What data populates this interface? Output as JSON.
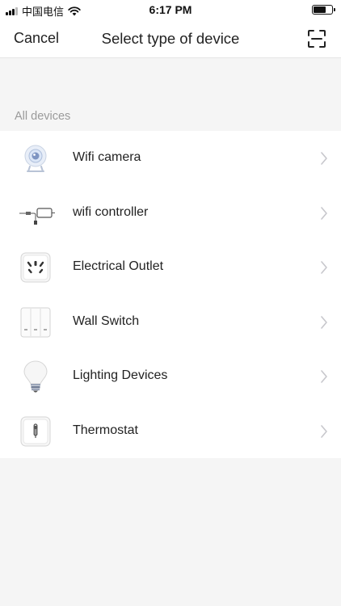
{
  "status_bar": {
    "carrier": "中国电信",
    "time": "6:17 PM"
  },
  "nav": {
    "cancel_label": "Cancel",
    "title": "Select type of device",
    "scan_icon": "scan-icon"
  },
  "section": {
    "header": "All devices"
  },
  "devices": [
    {
      "label": "Wifi camera",
      "icon": "camera-icon"
    },
    {
      "label": "wifi controller",
      "icon": "controller-icon"
    },
    {
      "label": "Electrical Outlet",
      "icon": "outlet-icon"
    },
    {
      "label": "Wall Switch",
      "icon": "wall-switch-icon"
    },
    {
      "label": "Lighting Devices",
      "icon": "light-bulb-icon"
    },
    {
      "label": "Thermostat",
      "icon": "thermostat-icon"
    }
  ],
  "colors": {
    "background": "#f5f5f5",
    "surface": "#ffffff",
    "section_text": "#9a9a9a",
    "chevron": "#c7c7cc"
  }
}
